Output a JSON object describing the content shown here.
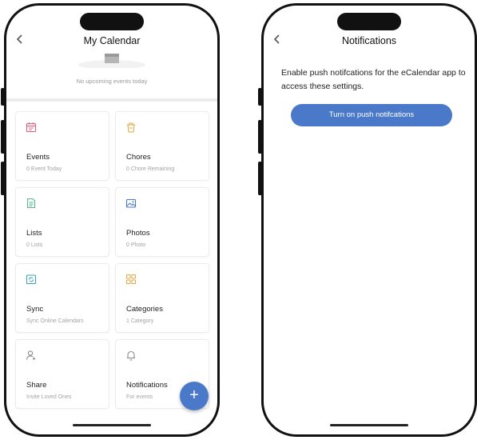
{
  "my_calendar_screen": {
    "title": "My Calendar",
    "back_icon": "chevron-left-icon",
    "empty_text": "No upcoming events today",
    "fab_label": "+",
    "cards": [
      {
        "title": "Events",
        "subtitle": "0 Event Today",
        "icon": "calendar-icon",
        "color": "#e0607a"
      },
      {
        "title": "Chores",
        "subtitle": "0 Chore Remaining",
        "icon": "chores-icon",
        "color": "#e0a84a"
      },
      {
        "title": "Lists",
        "subtitle": "0 Lists",
        "icon": "list-icon",
        "color": "#5bb58a"
      },
      {
        "title": "Photos",
        "subtitle": "0 Photo",
        "icon": "photo-icon",
        "color": "#4a79c9"
      },
      {
        "title": "Sync",
        "subtitle": "Sync Online Calendars",
        "icon": "sync-icon",
        "color": "#3ba5b0"
      },
      {
        "title": "Categories",
        "subtitle": "1 Category",
        "icon": "categories-icon",
        "color": "#e0a84a"
      },
      {
        "title": "Share",
        "subtitle": "Invite Loved Ones",
        "icon": "share-user-icon",
        "color": "#888888"
      },
      {
        "title": "Notifications",
        "subtitle": "For events",
        "icon": "bell-icon",
        "color": "#888888"
      }
    ]
  },
  "notifications_screen": {
    "title": "Notifications",
    "back_icon": "chevron-left-icon",
    "message": "Enable push notifcations for the eCalendar app to access these settings.",
    "button_label": "Turn on push notifcations",
    "button_color": "#4a79c9"
  }
}
